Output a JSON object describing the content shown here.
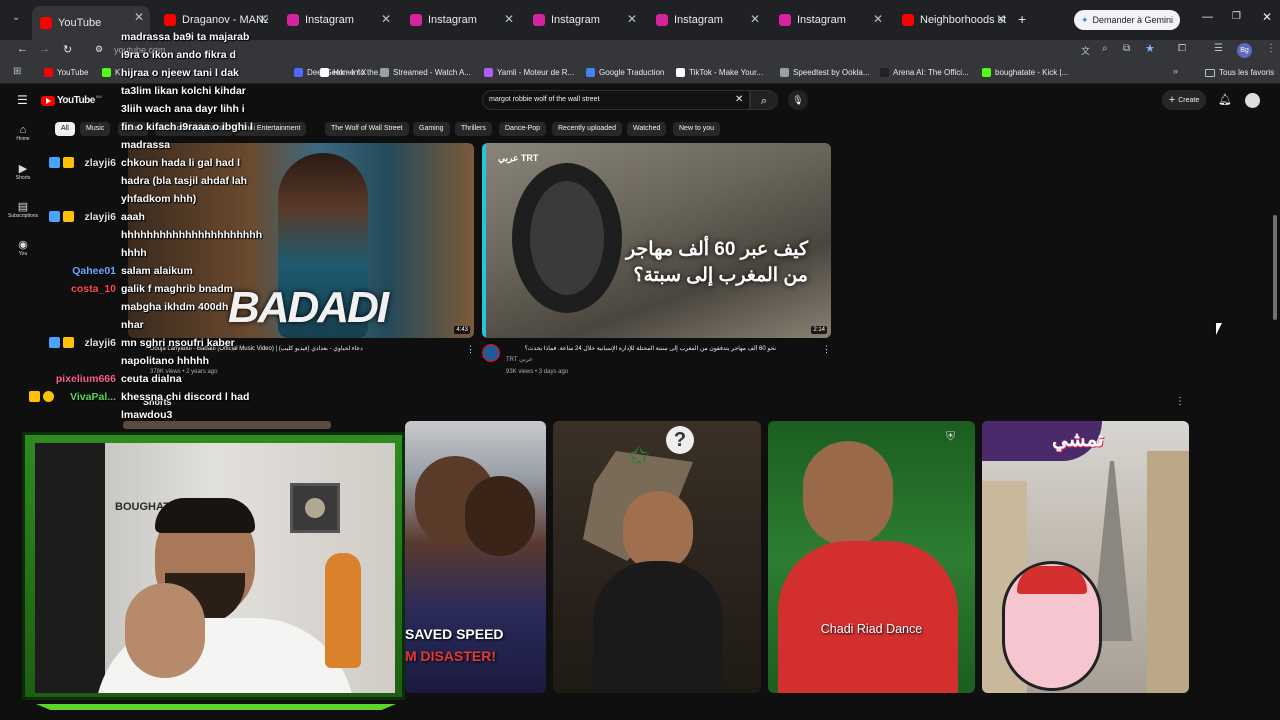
{
  "colors": {
    "chrome_bg": "#202124",
    "toolbar_bg": "#35363a",
    "yt_red": "#ff0000",
    "yt_bg": "#0f0f0f",
    "stream_green": "#3b9b1a"
  },
  "browser": {
    "tabs": [
      {
        "title": "YouTube",
        "icon": "youtube-icon",
        "color": "#ff0000"
      },
      {
        "title": "Draganov - MANZAN",
        "icon": "youtube-icon",
        "color": "#ff0000"
      },
      {
        "title": "Instagram",
        "icon": "instagram-icon",
        "color": "#d6249f"
      },
      {
        "title": "Instagram",
        "icon": "instagram-icon",
        "color": "#d6249f"
      },
      {
        "title": "Instagram",
        "icon": "instagram-icon",
        "color": "#d6249f"
      },
      {
        "title": "Instagram",
        "icon": "instagram-icon",
        "color": "#d6249f"
      },
      {
        "title": "Instagram",
        "icon": "instagram-icon",
        "color": "#d6249f"
      },
      {
        "title": "Neighborhoods still",
        "icon": "youtube-icon",
        "color": "#ff0000"
      }
    ],
    "gemini_button": "Demander à Gemini",
    "url": "youtube.com",
    "profile_initials": "Bg",
    "bookmarks": [
      {
        "label": "YouTube",
        "color": "#ff0000"
      },
      {
        "label": "K",
        "color": "#53fc18"
      },
      {
        "label": "DeepSeek - Into the...",
        "color": "#4d6bfe"
      },
      {
        "label": "Home / X",
        "color": "#ffffff"
      },
      {
        "label": "Streamed - Watch A...",
        "color": "#9aa0a6"
      },
      {
        "label": "Yamli - Moteur de R...",
        "color": "#b05cff"
      },
      {
        "label": "Google Traduction",
        "color": "#4285f4"
      },
      {
        "label": "TikTok - Make Your...",
        "color": "#ffffff"
      },
      {
        "label": "Speedtest by Ookla...",
        "color": "#9aa0a6"
      },
      {
        "label": "Arena AI: The Offici...",
        "color": "#222222"
      },
      {
        "label": "boughatate - Kick |...",
        "color": "#53fc18"
      }
    ],
    "all_bookmarks": "Tous les favoris"
  },
  "youtube": {
    "logo": "YouTube",
    "logo_region": "MA",
    "search_query": "margot robbie wolf of the wall street",
    "create_label": "Create",
    "chips": [
      "All",
      "Music",
      "Mixes",
      "Moroccan Rap Music",
      "Hindi Entertainment",
      "The Wolf of Wall Street",
      "Gaming",
      "Thrillers",
      "Dance-Pop",
      "Recently uploaded",
      "Watched",
      "New to you"
    ],
    "sidebar": [
      {
        "label": "Home",
        "icon": "home-icon"
      },
      {
        "label": "Shorts",
        "icon": "shorts-icon"
      },
      {
        "label": "Subscriptions",
        "icon": "subscriptions-icon"
      },
      {
        "label": "You",
        "icon": "you-icon"
      }
    ],
    "videos": [
      {
        "title": "Douja Lahyaoui - Badadi (Official Music Video) | (دعاء لحياوي - بعدادي (فيديو كليب",
        "channel": "Douja Lahyaoui",
        "meta": "378K views • 2 years ago",
        "duration": "4:43",
        "overlay": "BADADI"
      },
      {
        "title": "نحو 60 ألف مهاجر يتدفقون من المغرب إلى سبتة المحتلة للإدارة الإسبانية خلال 24 ساعة. فماذا يحدث؟",
        "channel": "TRT عربي",
        "meta": "93K views • 3 days ago",
        "duration": "2:14",
        "overlay": "كيف عبر 60 ألف مهاجر من المغرب إلى سبتة؟",
        "brand": "عربي TRT"
      }
    ],
    "shorts_label": "Shorts",
    "shorts": [
      {
        "caption": "SAVED SPEED",
        "caption2": "M DISASTER!"
      },
      {
        "caption": ""
      },
      {
        "caption": "Chadi Riad Dance"
      },
      {
        "caption": "تمشي"
      }
    ]
  },
  "stream": {
    "webcam_label": "BOUGHATATE",
    "chat": [
      {
        "user": "",
        "text": "madrassa ba9i ta majarab"
      },
      {
        "user": "",
        "text": "i9ra o ikon ando fikra d"
      },
      {
        "user": "",
        "text": "hijraa o njeew tani l dak"
      },
      {
        "user": "",
        "text": "ta3lim likan kolchi kihdar"
      },
      {
        "user": "",
        "text": "3liih wach ana dayr lihh i"
      },
      {
        "user": "",
        "text": "fin o kifach i9raaa o ibghi l"
      },
      {
        "user": "",
        "text": "madrassa"
      },
      {
        "user": "zlayji6",
        "text": "chkoun hada li gal had l",
        "color": "#e0e0e0"
      },
      {
        "user": "",
        "text": "hadra (bla tasjil ahdaf lah"
      },
      {
        "user": "",
        "text": "yhfadkom hhh)"
      },
      {
        "user": "zlayji6",
        "text": "aaah",
        "color": "#e0e0e0"
      },
      {
        "user": "",
        "text": "hhhhhhhhhhhhhhhhhhhhhh"
      },
      {
        "user": "",
        "text": "hhhh"
      },
      {
        "user": "Qahee01",
        "text": "salam alaikum",
        "color": "#6ea8ff"
      },
      {
        "user": "costa_10",
        "text": "galik f maghrib bnadm",
        "color": "#ff4a4a"
      },
      {
        "user": "",
        "text": "mabgha ikhdm 400dh"
      },
      {
        "user": "",
        "text": "nhar"
      },
      {
        "user": "zlayji6",
        "text": "mn sghri nsoufri kaber",
        "color": "#e0e0e0"
      },
      {
        "user": "",
        "text": "napolitano hhhhh"
      },
      {
        "user": "pixelium666",
        "text": "ceuta dialna",
        "color": "#ff5c8a"
      },
      {
        "user": "VivaPal...",
        "text": "khessna chi discord l had",
        "color": "#5cd65c"
      },
      {
        "user": "",
        "text": "lmawdou3"
      }
    ]
  }
}
